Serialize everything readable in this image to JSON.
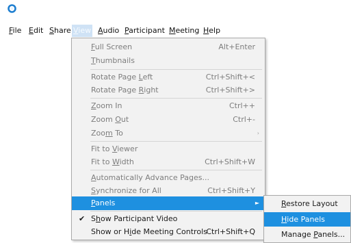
{
  "menubar": [
    {
      "pre": "",
      "key": "F",
      "post": "ile"
    },
    {
      "pre": "",
      "key": "E",
      "post": "dit"
    },
    {
      "pre": "",
      "key": "S",
      "post": "hare"
    },
    {
      "pre": "",
      "key": "V",
      "post": "iew"
    },
    {
      "pre": "",
      "key": "A",
      "post": "udio"
    },
    {
      "pre": "",
      "key": "P",
      "post": "articipant"
    },
    {
      "pre": "",
      "key": "M",
      "post": "eeting"
    },
    {
      "pre": "",
      "key": "H",
      "post": "elp"
    }
  ],
  "view_menu": {
    "full_screen": {
      "pre": "",
      "key": "F",
      "post": "ull Screen",
      "shortcut": "Alt+Enter"
    },
    "thumbnails": {
      "pre": "",
      "key": "T",
      "post": "humbnails"
    },
    "rotate_left": {
      "pre": "Rotate Page ",
      "key": "L",
      "post": "eft",
      "shortcut": "Ctrl+Shift+<"
    },
    "rotate_right": {
      "pre": "Rotate Page ",
      "key": "R",
      "post": "ight",
      "shortcut": "Ctrl+Shift+>"
    },
    "zoom_in": {
      "pre": "",
      "key": "Z",
      "post": "oom In",
      "shortcut": "Ctrl++"
    },
    "zoom_out": {
      "pre": "Zoom ",
      "key": "O",
      "post": "ut",
      "shortcut": "Ctrl+-"
    },
    "zoom_to": {
      "pre": "Zoo",
      "key": "m",
      "post": " To",
      "arrow": "›"
    },
    "fit_viewer": {
      "pre": "Fit to ",
      "key": "V",
      "post": "iewer"
    },
    "fit_width": {
      "pre": "Fit to ",
      "key": "W",
      "post": "idth",
      "shortcut": "Ctrl+Shift+W"
    },
    "auto_advance": {
      "pre": "",
      "key": "A",
      "post": "utomatically Advance Pages..."
    },
    "synchronize": {
      "pre": "",
      "key": "S",
      "post": "ynchronize for All",
      "shortcut": "Ctrl+Shift+Y"
    },
    "panels": {
      "pre": "",
      "key": "P",
      "post": "anels",
      "arrow": "►"
    },
    "show_video": {
      "pre": "S",
      "key": "h",
      "post": "ow Participant Video",
      "check": "✔"
    },
    "show_hide_controls": {
      "pre": "Show or H",
      "key": "i",
      "post": "de Meeting Controls",
      "shortcut": "Ctrl+Shift+Q"
    }
  },
  "panels_submenu": {
    "restore_layout": {
      "pre": "",
      "key": "R",
      "post": "estore Layout"
    },
    "hide_panels": {
      "pre": "",
      "key": "H",
      "post": "ide Panels"
    },
    "manage_panels": {
      "pre": "Manage ",
      "key": "P",
      "post": "anels..."
    }
  },
  "colors": {
    "highlight": "#1e90e0",
    "menu_bg": "#f2f2f2",
    "view_menu_active": "#cfe2f5",
    "app_icon": "#1f7fd0"
  }
}
